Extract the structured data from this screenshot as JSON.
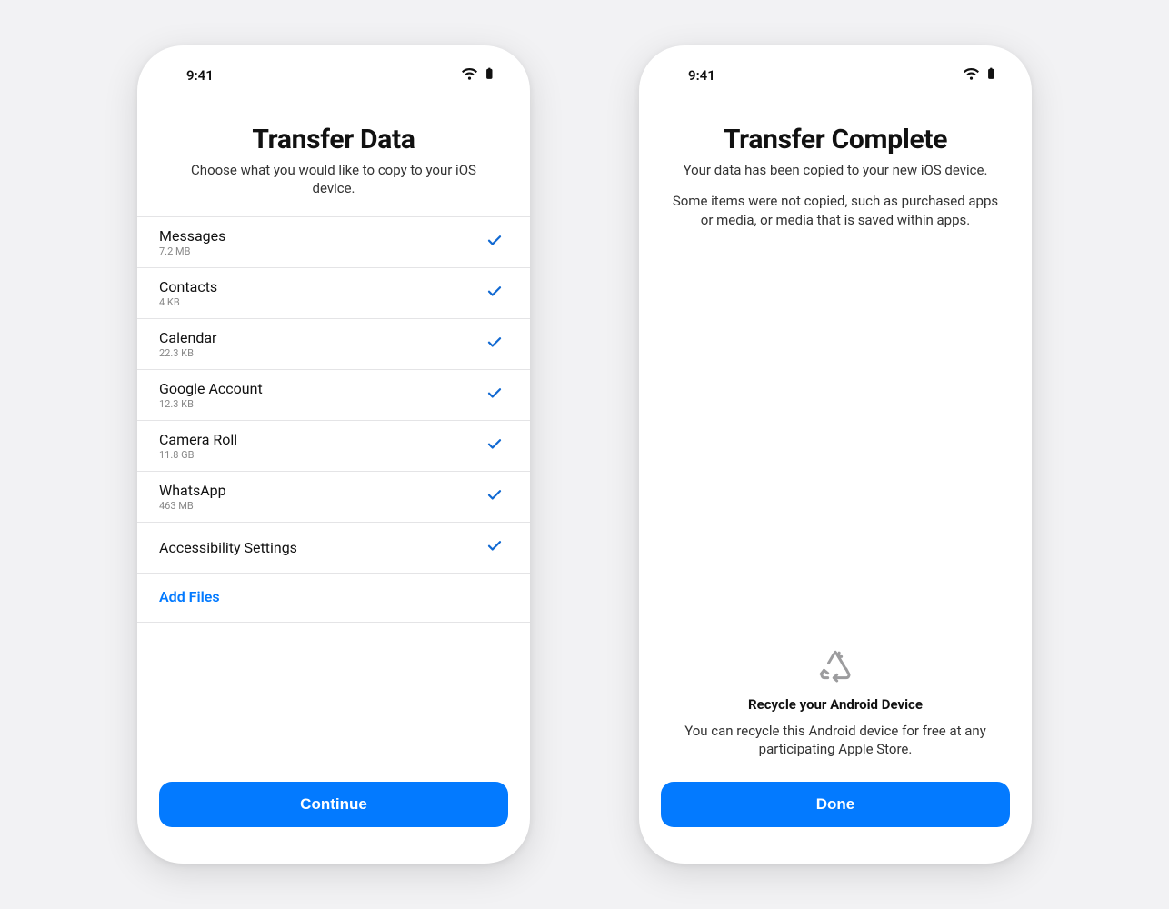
{
  "status": {
    "time": "9:41"
  },
  "screen1": {
    "title": "Transfer Data",
    "subtitle": "Choose what you would like to copy to your iOS device.",
    "items": [
      {
        "label": "Messages",
        "size": "7.2 MB",
        "checked": true
      },
      {
        "label": "Contacts",
        "size": "4 KB",
        "checked": true
      },
      {
        "label": "Calendar",
        "size": "22.3 KB",
        "checked": true
      },
      {
        "label": "Google Account",
        "size": "12.3 KB",
        "checked": true
      },
      {
        "label": "Camera Roll",
        "size": "11.8 GB",
        "checked": true
      },
      {
        "label": "WhatsApp",
        "size": "463 MB",
        "checked": true
      },
      {
        "label": "Accessibility Settings",
        "size": "",
        "checked": true
      }
    ],
    "add_files": "Add Files",
    "continue_btn": "Continue"
  },
  "screen2": {
    "title": "Transfer Complete",
    "subtitle": "Your data has been copied to your new iOS device.",
    "subtitle2": "Some items were not copied, such as purchased apps or media, or media that is saved within apps.",
    "recycle_title": "Recycle your Android Device",
    "recycle_text": "You can recycle this Android device for free at any participating Apple Store.",
    "done_btn": "Done"
  }
}
